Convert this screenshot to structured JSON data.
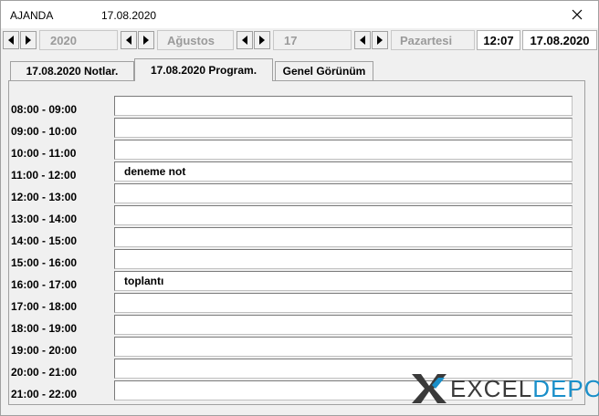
{
  "window": {
    "app_title": "AJANDA",
    "title_date": "17.08.2020"
  },
  "nav": {
    "year": "2020",
    "month": "Ağustos",
    "day": "17",
    "weekday": "Pazartesi",
    "time": "12:07",
    "date": "17.08.2020"
  },
  "tabs": [
    {
      "label": "17.08.2020  Notlar."
    },
    {
      "label": "17.08.2020  Program."
    },
    {
      "label": "Genel Görünüm"
    }
  ],
  "schedule": [
    {
      "time": "08:00 - 09:00",
      "note": ""
    },
    {
      "time": "09:00 - 10:00",
      "note": ""
    },
    {
      "time": "10:00 - 11:00",
      "note": ""
    },
    {
      "time": "11:00 - 12:00",
      "note": "deneme not"
    },
    {
      "time": "12:00 - 13:00",
      "note": ""
    },
    {
      "time": "13:00 - 14:00",
      "note": ""
    },
    {
      "time": "14:00 - 15:00",
      "note": ""
    },
    {
      "time": "15:00 - 16:00",
      "note": ""
    },
    {
      "time": "16:00 - 17:00",
      "note": "toplantı"
    },
    {
      "time": "17:00 - 18:00",
      "note": ""
    },
    {
      "time": "18:00 - 19:00",
      "note": ""
    },
    {
      "time": "19:00 - 20:00",
      "note": ""
    },
    {
      "time": "20:00 - 21:00",
      "note": ""
    },
    {
      "time": "21:00 - 22:00",
      "note": ""
    }
  ],
  "logo": {
    "part1": "EXCEL",
    "part2": "DEPO",
    "colors": {
      "dark": "#3a3a3a",
      "accent": "#1a8fc9"
    }
  }
}
